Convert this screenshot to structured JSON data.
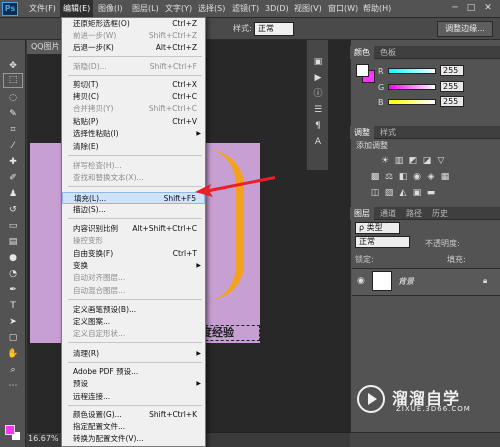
{
  "app": {
    "logo": "Ps"
  },
  "menubar": [
    "文件(F)",
    "编辑(E)",
    "图像(I)",
    "图层(L)",
    "文字(Y)",
    "选择(S)",
    "滤镜(T)",
    "3D(D)",
    "视图(V)",
    "窗口(W)",
    "帮助(H)"
  ],
  "window_controls": [
    "─",
    "□",
    "✕"
  ],
  "options_bar": {
    "style_label": "样式:",
    "style_value": "正常",
    "refine_edge": "调整边缘..."
  },
  "document": {
    "tab": "QQ图片",
    "zoom": "16.67%",
    "canvas_caption": "度经验",
    "canvas_color": "#c89fd3"
  },
  "color_panel": {
    "tabs": [
      "颜色",
      "色板"
    ],
    "r_label": "R",
    "g_label": "G",
    "b_label": "B",
    "r": "255",
    "g": "255",
    "b": "255"
  },
  "adjust_panel": {
    "tabs": [
      "调整",
      "样式"
    ],
    "title": "添加调整"
  },
  "layers_panel": {
    "tabs": [
      "图层",
      "通道",
      "路径",
      "历史"
    ],
    "kind": "ρ 类型",
    "blend": "正常",
    "opacity_label": "不透明度:",
    "lock_label": "锁定:",
    "fill_label": "填充:",
    "layer_name": "背景"
  },
  "watermark": {
    "title": "溜溜自学",
    "subtitle": "ZIXUE.3D66.COM"
  },
  "edit_menu": [
    {
      "label": "还原矩形选框(O)",
      "shortcut": "Ctrl+Z",
      "disabled": false
    },
    {
      "label": "前进一步(W)",
      "shortcut": "Shift+Ctrl+Z",
      "disabled": true
    },
    {
      "label": "后退一步(K)",
      "shortcut": "Alt+Ctrl+Z",
      "disabled": false
    },
    {
      "sep": true
    },
    {
      "label": "渐隐(D)...",
      "shortcut": "Shift+Ctrl+F",
      "disabled": true
    },
    {
      "sep": true
    },
    {
      "label": "剪切(T)",
      "shortcut": "Ctrl+X",
      "disabled": false
    },
    {
      "label": "拷贝(C)",
      "shortcut": "Ctrl+C",
      "disabled": false
    },
    {
      "label": "合并拷贝(Y)",
      "shortcut": "Shift+Ctrl+C",
      "disabled": true
    },
    {
      "label": "粘贴(P)",
      "shortcut": "Ctrl+V",
      "disabled": false
    },
    {
      "label": "选择性粘贴(I)",
      "shortcut": "",
      "disabled": false,
      "submenu": true
    },
    {
      "label": "清除(E)",
      "shortcut": "",
      "disabled": false
    },
    {
      "sep": true
    },
    {
      "label": "拼写检查(H)...",
      "shortcut": "",
      "disabled": true
    },
    {
      "label": "查找和替换文本(X)...",
      "shortcut": "",
      "disabled": true
    },
    {
      "sep": true
    },
    {
      "label": "填充(L)...",
      "shortcut": "Shift+F5",
      "disabled": false,
      "highlight": true
    },
    {
      "label": "描边(S)...",
      "shortcut": "",
      "disabled": false
    },
    {
      "sep": true
    },
    {
      "label": "内容识别比例",
      "shortcut": "Alt+Shift+Ctrl+C",
      "disabled": false
    },
    {
      "label": "操控变形",
      "shortcut": "",
      "disabled": true
    },
    {
      "label": "自由变换(F)",
      "shortcut": "Ctrl+T",
      "disabled": false
    },
    {
      "label": "变换",
      "shortcut": "",
      "disabled": false,
      "submenu": true
    },
    {
      "label": "自动对齐图层...",
      "shortcut": "",
      "disabled": true
    },
    {
      "label": "自动混合图层...",
      "shortcut": "",
      "disabled": true
    },
    {
      "sep": true
    },
    {
      "label": "定义画笔预设(B)...",
      "shortcut": "",
      "disabled": false
    },
    {
      "label": "定义图案...",
      "shortcut": "",
      "disabled": false
    },
    {
      "label": "定义自定形状...",
      "shortcut": "",
      "disabled": true
    },
    {
      "sep": true
    },
    {
      "label": "清理(R)",
      "shortcut": "",
      "disabled": false,
      "submenu": true
    },
    {
      "sep": true
    },
    {
      "label": "Adobe PDF 预设...",
      "shortcut": "",
      "disabled": false
    },
    {
      "label": "预设",
      "shortcut": "",
      "disabled": false,
      "submenu": true
    },
    {
      "label": "远程连接...",
      "shortcut": "",
      "disabled": false
    },
    {
      "sep": true
    },
    {
      "label": "颜色设置(G)...",
      "shortcut": "Shift+Ctrl+K",
      "disabled": false
    },
    {
      "label": "指定配置文件...",
      "shortcut": "",
      "disabled": false
    },
    {
      "label": "转换为配置文件(V)...",
      "shortcut": "",
      "disabled": false
    }
  ]
}
